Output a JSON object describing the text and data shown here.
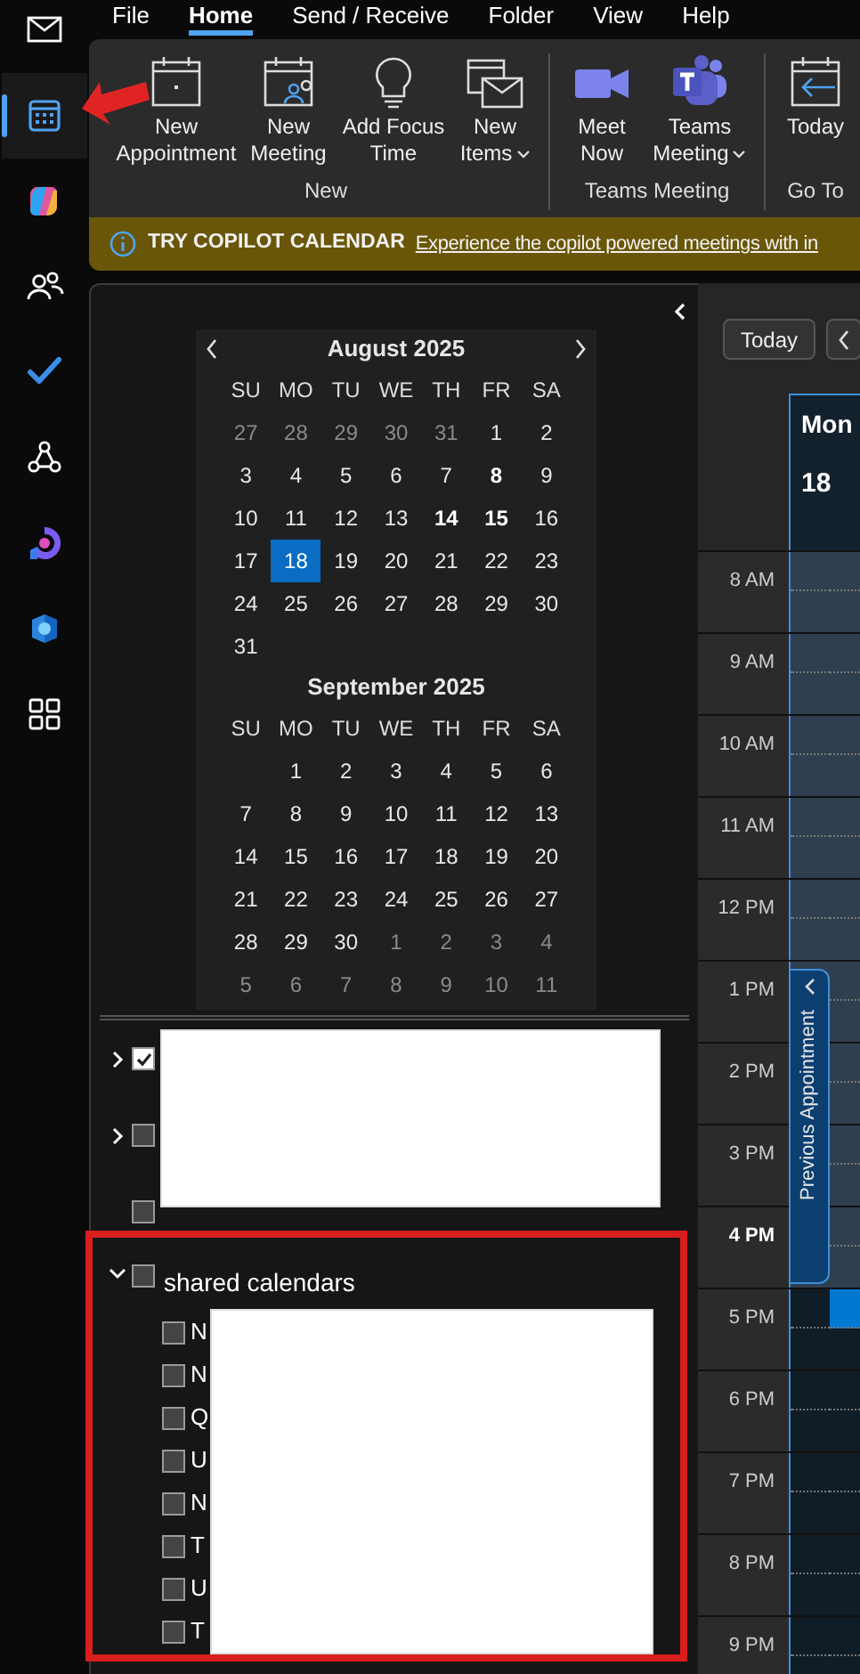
{
  "nav_rail": [
    {
      "selected": false
    },
    {
      "selected": true
    },
    {
      "selected": false
    },
    {
      "selected": false
    },
    {
      "selected": false
    },
    {
      "selected": false
    },
    {
      "selected": false
    },
    {
      "selected": false
    },
    {
      "selected": false
    }
  ],
  "menu": [
    {
      "label": "File",
      "selected": false
    },
    {
      "label": "Home",
      "selected": true
    },
    {
      "label": "Send / Receive",
      "selected": false
    },
    {
      "label": "Folder",
      "selected": false
    },
    {
      "label": "View",
      "selected": false
    },
    {
      "label": "Help",
      "selected": false
    }
  ],
  "ribbon": [
    {
      "label": "New",
      "buttons": [
        {
          "label": "New Appointment",
          "dropdown": false
        },
        {
          "label": "New Meeting",
          "dropdown": false
        },
        {
          "label": "Add Focus Time",
          "dropdown": false
        },
        {
          "label": "New Items",
          "dropdown": true
        }
      ]
    },
    {
      "label": "Teams Meeting",
      "buttons": [
        {
          "label": "Meet Now",
          "dropdown": false
        },
        {
          "label": "Teams Meeting",
          "dropdown": true
        }
      ]
    },
    {
      "label": "Go To",
      "buttons": [
        {
          "label": "Today",
          "dropdown": false
        }
      ]
    }
  ],
  "banner": {
    "title": "TRY COPILOT CALENDAR",
    "link": "Experience the copilot powered meetings with in"
  },
  "mini_calendars": [
    {
      "title": "August 2025",
      "arrows": true,
      "weekdays": [
        "SU",
        "MO",
        "TU",
        "WE",
        "TH",
        "FR",
        "SA"
      ],
      "weeks": [
        [
          {
            "d": "27",
            "kind": "adjacent",
            "selected": false
          },
          {
            "d": "28",
            "kind": "adjacent",
            "selected": false
          },
          {
            "d": "29",
            "kind": "adjacent",
            "selected": false
          },
          {
            "d": "30",
            "kind": "adjacent",
            "selected": false
          },
          {
            "d": "31",
            "kind": "adjacent",
            "selected": false
          },
          {
            "d": "1",
            "kind": "day",
            "selected": false
          },
          {
            "d": "2",
            "kind": "day",
            "selected": false
          }
        ],
        [
          {
            "d": "3",
            "kind": "day",
            "selected": false
          },
          {
            "d": "4",
            "kind": "day",
            "selected": false
          },
          {
            "d": "5",
            "kind": "day",
            "selected": false
          },
          {
            "d": "6",
            "kind": "day",
            "selected": false
          },
          {
            "d": "7",
            "kind": "day",
            "selected": false
          },
          {
            "d": "8",
            "kind": "busy",
            "selected": false
          },
          {
            "d": "9",
            "kind": "day",
            "selected": false
          }
        ],
        [
          {
            "d": "10",
            "kind": "day",
            "selected": false
          },
          {
            "d": "11",
            "kind": "day",
            "selected": false
          },
          {
            "d": "12",
            "kind": "day",
            "selected": false
          },
          {
            "d": "13",
            "kind": "day",
            "selected": false
          },
          {
            "d": "14",
            "kind": "busy",
            "selected": false
          },
          {
            "d": "15",
            "kind": "busy",
            "selected": false
          },
          {
            "d": "16",
            "kind": "day",
            "selected": false
          }
        ],
        [
          {
            "d": "17",
            "kind": "day",
            "selected": false
          },
          {
            "d": "18",
            "kind": "day",
            "selected": true
          },
          {
            "d": "19",
            "kind": "day",
            "selected": false
          },
          {
            "d": "20",
            "kind": "day",
            "selected": false
          },
          {
            "d": "21",
            "kind": "day",
            "selected": false
          },
          {
            "d": "22",
            "kind": "day",
            "selected": false
          },
          {
            "d": "23",
            "kind": "day",
            "selected": false
          }
        ],
        [
          {
            "d": "24",
            "kind": "day",
            "selected": false
          },
          {
            "d": "25",
            "kind": "day",
            "selected": false
          },
          {
            "d": "26",
            "kind": "day",
            "selected": false
          },
          {
            "d": "27",
            "kind": "day",
            "selected": false
          },
          {
            "d": "28",
            "kind": "day",
            "selected": false
          },
          {
            "d": "29",
            "kind": "day",
            "selected": false
          },
          {
            "d": "30",
            "kind": "day",
            "selected": false
          }
        ],
        [
          {
            "d": "31",
            "kind": "day",
            "selected": false
          }
        ]
      ]
    },
    {
      "title": "September 2025",
      "arrows": false,
      "weekdays": [
        "SU",
        "MO",
        "TU",
        "WE",
        "TH",
        "FR",
        "SA"
      ],
      "weeks": [
        [
          {
            "d": "1",
            "kind": "day",
            "selected": false
          },
          {
            "d": "2",
            "kind": "day",
            "selected": false
          },
          {
            "d": "3",
            "kind": "day",
            "selected": false
          },
          {
            "d": "4",
            "kind": "day",
            "selected": false
          },
          {
            "d": "5",
            "kind": "day",
            "selected": false
          },
          {
            "d": "6",
            "kind": "day",
            "selected": false
          }
        ],
        [
          {
            "d": "7",
            "kind": "day",
            "selected": false
          },
          {
            "d": "8",
            "kind": "day",
            "selected": false
          },
          {
            "d": "9",
            "kind": "day",
            "selected": false
          },
          {
            "d": "10",
            "kind": "day",
            "selected": false
          },
          {
            "d": "11",
            "kind": "day",
            "selected": false
          },
          {
            "d": "12",
            "kind": "day",
            "selected": false
          },
          {
            "d": "13",
            "kind": "day",
            "selected": false
          }
        ],
        [
          {
            "d": "14",
            "kind": "day",
            "selected": false
          },
          {
            "d": "15",
            "kind": "day",
            "selected": false
          },
          {
            "d": "16",
            "kind": "day",
            "selected": false
          },
          {
            "d": "17",
            "kind": "day",
            "selected": false
          },
          {
            "d": "18",
            "kind": "day",
            "selected": false
          },
          {
            "d": "19",
            "kind": "day",
            "selected": false
          },
          {
            "d": "20",
            "kind": "day",
            "selected": false
          }
        ],
        [
          {
            "d": "21",
            "kind": "day",
            "selected": false
          },
          {
            "d": "22",
            "kind": "day",
            "selected": false
          },
          {
            "d": "23",
            "kind": "day",
            "selected": false
          },
          {
            "d": "24",
            "kind": "day",
            "selected": false
          },
          {
            "d": "25",
            "kind": "day",
            "selected": false
          },
          {
            "d": "26",
            "kind": "day",
            "selected": false
          },
          {
            "d": "27",
            "kind": "day",
            "selected": false
          }
        ],
        [
          {
            "d": "28",
            "kind": "day",
            "selected": false
          },
          {
            "d": "29",
            "kind": "day",
            "selected": false
          },
          {
            "d": "30",
            "kind": "day",
            "selected": false
          },
          {
            "d": "1",
            "kind": "adjacent",
            "selected": false
          },
          {
            "d": "2",
            "kind": "adjacent",
            "selected": false
          },
          {
            "d": "3",
            "kind": "adjacent",
            "selected": false
          },
          {
            "d": "4",
            "kind": "adjacent",
            "selected": false
          }
        ],
        [
          {
            "d": "5",
            "kind": "adjacent",
            "selected": false
          },
          {
            "d": "6",
            "kind": "adjacent",
            "selected": false
          },
          {
            "d": "7",
            "kind": "adjacent",
            "selected": false
          },
          {
            "d": "8",
            "kind": "adjacent",
            "selected": false
          },
          {
            "d": "9",
            "kind": "adjacent",
            "selected": false
          },
          {
            "d": "10",
            "kind": "adjacent",
            "selected": false
          },
          {
            "d": "11",
            "kind": "adjacent",
            "selected": false
          }
        ]
      ]
    }
  ],
  "calendar_groups": [
    {
      "expanded": false,
      "checked": true
    },
    {
      "expanded": false,
      "checked": false
    },
    {
      "checked": false
    },
    {
      "label": "shared calendars",
      "expanded": true,
      "checked": false,
      "children": [
        {
          "label": "N",
          "checked": false
        },
        {
          "label": "N",
          "checked": false
        },
        {
          "label": "Q",
          "checked": false
        },
        {
          "label": "U",
          "checked": false
        },
        {
          "label": "N",
          "checked": false
        },
        {
          "label": "T",
          "checked": false
        },
        {
          "label": "U",
          "checked": false
        },
        {
          "label": "T",
          "checked": false
        }
      ]
    }
  ],
  "day_view": {
    "today_button": "Today",
    "day_name": "Mon",
    "day_number": "18",
    "previous_appointment": "Previous Appointment",
    "hours": [
      {
        "label": "8 AM",
        "work": true,
        "current": false,
        "selected": false
      },
      {
        "label": "9 AM",
        "work": true,
        "current": false,
        "selected": false
      },
      {
        "label": "10 AM",
        "work": true,
        "current": false,
        "selected": false
      },
      {
        "label": "11 AM",
        "work": true,
        "current": false,
        "selected": false
      },
      {
        "label": "12 PM",
        "work": true,
        "current": false,
        "selected": false
      },
      {
        "label": "1 PM",
        "work": true,
        "current": false,
        "selected": false
      },
      {
        "label": "2 PM",
        "work": true,
        "current": false,
        "selected": false
      },
      {
        "label": "3 PM",
        "work": true,
        "current": false,
        "selected": false
      },
      {
        "label": "4 PM",
        "work": true,
        "current": true,
        "selected": false
      },
      {
        "label": "5 PM",
        "work": false,
        "current": false,
        "selected": true
      },
      {
        "label": "6 PM",
        "work": false,
        "current": false,
        "selected": false
      },
      {
        "label": "7 PM",
        "work": false,
        "current": false,
        "selected": false
      },
      {
        "label": "8 PM",
        "work": false,
        "current": false,
        "selected": false
      },
      {
        "label": "9 PM",
        "work": false,
        "current": false,
        "selected": false
      }
    ]
  }
}
